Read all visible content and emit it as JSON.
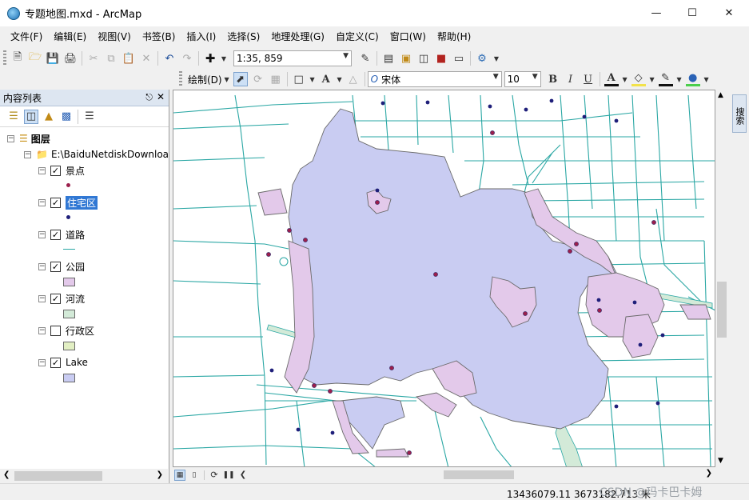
{
  "window": {
    "title": "专题地图.mxd - ArcMap"
  },
  "menu": [
    "文件(F)",
    "编辑(E)",
    "视图(V)",
    "书签(B)",
    "插入(I)",
    "选择(S)",
    "地理处理(G)",
    "自定义(C)",
    "窗口(W)",
    "帮助(H)"
  ],
  "toolbar": {
    "scale": "1:35, 859",
    "draw_label": "绘制(D)",
    "font_name": "宋体",
    "font_size": "10",
    "bold": "B",
    "italic": "I",
    "underline": "U",
    "font_color_glyph": "A"
  },
  "toc": {
    "title": "内容列表",
    "root_label": "图层",
    "folder_label": "E:\\BaiduNetdiskDownloa",
    "layers": [
      {
        "name": "景点",
        "checked": true,
        "symbol": "point",
        "color": "#9b1f4c"
      },
      {
        "name": "住宅区",
        "checked": true,
        "symbol": "point",
        "color": "#1f1f7a",
        "selected": true
      },
      {
        "name": "道路",
        "checked": true,
        "symbol": "line",
        "color": "#2aa7a4"
      },
      {
        "name": "公园",
        "checked": true,
        "symbol": "fill",
        "color": "#e3c9ea"
      },
      {
        "name": "河流",
        "checked": true,
        "symbol": "fill",
        "color": "#d3ead8"
      },
      {
        "name": "行政区",
        "checked": false,
        "symbol": "fill",
        "color": "#e2efc3"
      },
      {
        "name": "Lake",
        "checked": true,
        "symbol": "fill",
        "color": "#c9ccf2"
      }
    ]
  },
  "side_tab": "搜索",
  "status": {
    "coords": "13436079.11  3673182.713 米"
  },
  "watermark": "CSDN @玛卡巴卡姆"
}
